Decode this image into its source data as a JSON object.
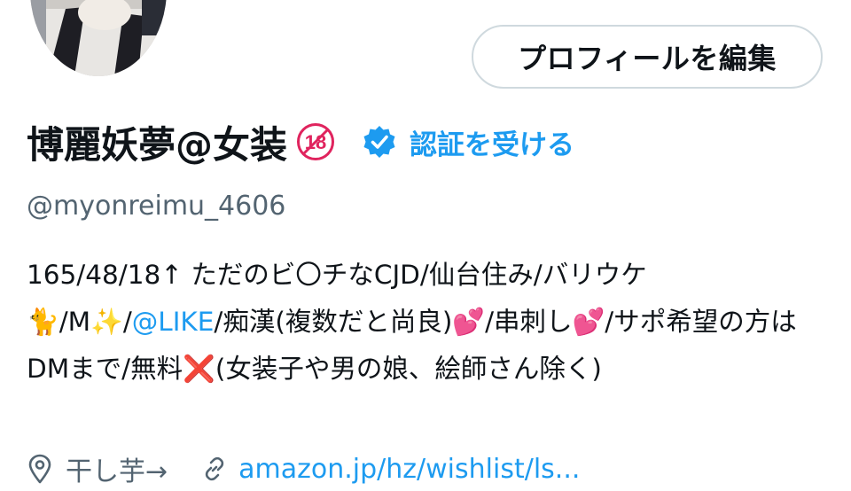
{
  "profile": {
    "display_name": "博麗妖夢@女装",
    "age_badge_label": "18",
    "verify_label": "認証を受ける",
    "handle": "@myonreimu_4606",
    "edit_button_label": "プロフィールを編集",
    "bio_segments": [
      "165/48/18↑ ただのビ〇チなCJD/仙台住み/バリウケ🐈/M✨/",
      "@LIKE",
      "/痴漢(複数だと尚良)💕/串刺し💕/サポ希望の方はDMまで/無料❌(女装子や男の娘、絵師さん除く)"
    ],
    "location": "干し芋→",
    "website": "amazon.jp/hz/wishlist/ls..."
  },
  "icons": {
    "verified": "verified-badge-icon",
    "age_restriction": "no-under-18-icon",
    "location": "map-pin-icon",
    "link": "link-icon"
  },
  "colors": {
    "link_blue": "#1d9bf0",
    "secondary_text": "#536471",
    "primary_text": "#0f1419",
    "button_border": "#cfd9de",
    "age_badge_red": "#e0245e"
  }
}
